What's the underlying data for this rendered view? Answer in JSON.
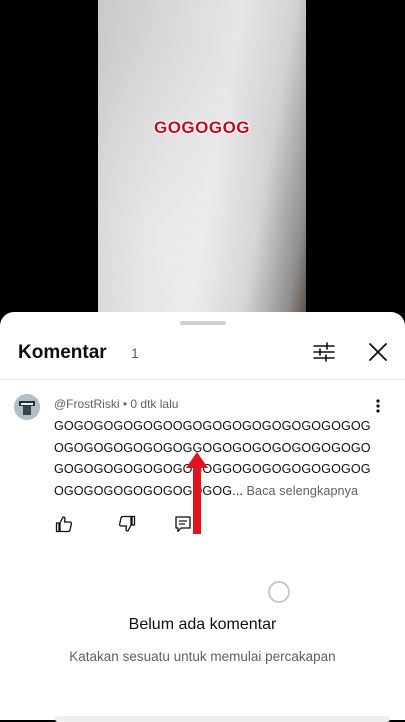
{
  "video": {
    "caption": "GOGOGOG"
  },
  "comments_panel": {
    "title": "Komentar",
    "count": "1",
    "comment": {
      "author": "@FrostRiski",
      "time": "0 dtk lalu",
      "meta": "@FrostRiski • 0 dtk lalu",
      "text": "GOGOGOGOGOGOOGOGOGOGOGOGOGOGOGOGOGOGOGOGOGOGOGGOGOGOGOGOGOGOGOGOGOGOGOGOGOGOGOGOGGOGOGOGOGOGOGOGOGOGOGOGOGOGOGOGOG...",
      "read_more": "Baca selengkapnya"
    },
    "empty_state": {
      "title": "Belum ada komentar",
      "subtitle": "Katakan sesuatu untuk memulai percakapan"
    },
    "icons": [
      "filter-icon",
      "close-icon",
      "kebab-icon",
      "like-icon",
      "dislike-icon",
      "reply-icon"
    ],
    "accent_color": "#e0141e"
  }
}
